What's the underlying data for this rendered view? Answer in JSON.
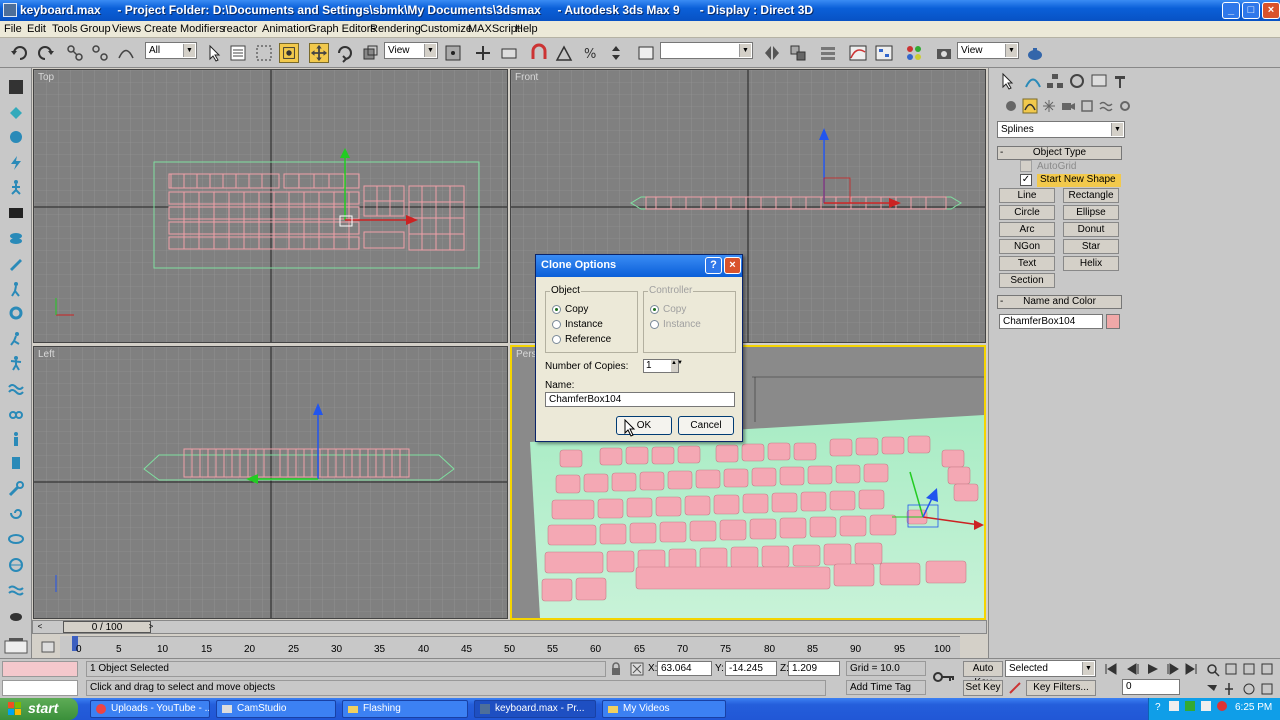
{
  "window": {
    "title": "keyboard.max     - Project Folder: D:\\Documents and Settings\\sbmk\\My Documents\\3dsmax     - Autodesk 3ds Max 9      - Display : Direct 3D"
  },
  "menu": [
    "File",
    "Edit",
    "Tools",
    "Group",
    "Views",
    "Create",
    "Modifiers",
    "reactor",
    "Animation",
    "Graph Editors",
    "Rendering",
    "Customize",
    "MAXScript",
    "Help"
  ],
  "toolbar": {
    "selection_filter": "All",
    "ref_coord_1": "View",
    "ref_coord_2": "View",
    "named_selection": ""
  },
  "viewports": {
    "top_label": "Top",
    "front_label": "Front",
    "left_label": "Left",
    "perspective_label": "Persp"
  },
  "dialog": {
    "title": "Clone Options",
    "object_group": "Object",
    "controller_group": "Controller",
    "options": [
      "Copy",
      "Instance",
      "Reference"
    ],
    "controller_options": [
      "Copy",
      "Instance"
    ],
    "selected_option": "Copy",
    "copies_label": "Number of Copies:",
    "copies_value": "1",
    "name_label": "Name:",
    "name_value": "ChamferBox104",
    "ok_label": "OK",
    "cancel_label": "Cancel"
  },
  "command_panel": {
    "category": "Splines",
    "object_type_header": "Object Type",
    "autogrid_label": "AutoGrid",
    "start_new_shape_label": "Start New Shape",
    "buttons": [
      "Line",
      "Rectangle",
      "Circle",
      "Ellipse",
      "Arc",
      "Donut",
      "NGon",
      "Star",
      "Text",
      "Helix",
      "Section"
    ],
    "name_color_header": "Name and Color",
    "object_name": "ChamferBox104",
    "object_color": "#f0a8a8"
  },
  "timeline": {
    "frame_display": "0 / 100",
    "ticks": [
      "0",
      "5",
      "10",
      "15",
      "20",
      "25",
      "30",
      "35",
      "40",
      "45",
      "50",
      "55",
      "60",
      "65",
      "70",
      "75",
      "80",
      "85",
      "90",
      "95",
      "100"
    ]
  },
  "status": {
    "selection": "1 Object Selected",
    "prompt": "Click and drag to select and move objects",
    "x_label": "X:",
    "x_value": "63.064",
    "y_label": "Y:",
    "y_value": "-14.245",
    "z_label": "Z:",
    "z_value": "1.209",
    "grid": "Grid = 10.0",
    "add_time_tag": "Add Time Tag",
    "auto_key": "Auto Key",
    "set_key": "Set Key",
    "key_mode": "Selected",
    "key_filters": "Key Filters...",
    "frame_field": "0"
  },
  "taskbar": {
    "start_label": "start",
    "tasks": [
      "Uploads - YouTube - ...",
      "CamStudio",
      "Flashing",
      "keyboard.max     - Pr...",
      "My Videos"
    ],
    "active_task": "keyboard.max     - Pr...",
    "clock": "6:25 PM"
  }
}
